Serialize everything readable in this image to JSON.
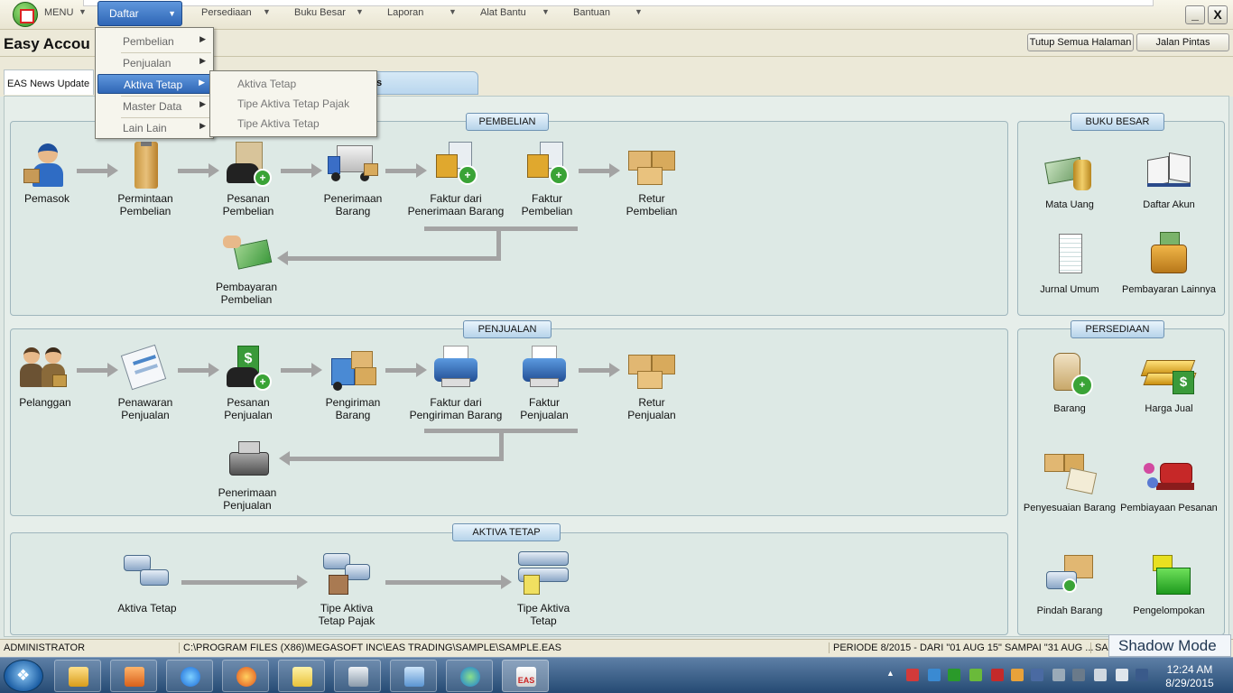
{
  "menubar": {
    "menu_label": "MENU",
    "items": [
      {
        "label": "Daftar"
      },
      {
        "label": "Persediaan"
      },
      {
        "label": "Buku Besar"
      },
      {
        "label": "Laporan"
      },
      {
        "label": "Alat Bantu"
      },
      {
        "label": "Bantuan"
      }
    ],
    "minimize": "_",
    "close": "X"
  },
  "dropdown": {
    "items": [
      {
        "label": "Pembelian"
      },
      {
        "label": "Penjualan"
      },
      {
        "label": "Aktiva Tetap"
      },
      {
        "label": "Master Data"
      },
      {
        "label": "Lain Lain"
      }
    ],
    "submenu": [
      {
        "label": "Aktiva Tetap"
      },
      {
        "label": "Tipe Aktiva Tetap Pajak"
      },
      {
        "label": "Tipe Aktiva Tetap"
      }
    ]
  },
  "titlebar": {
    "title": "Easy Accou",
    "buttons": [
      {
        "label": "Tutup Semua Halaman"
      },
      {
        "label": "Jalan Pintas"
      }
    ]
  },
  "tabs": [
    {
      "label": "EAS News Update"
    },
    {
      "label": "s"
    }
  ],
  "pembelian": {
    "title": "PEMBELIAN",
    "nodes": [
      {
        "label": "Pemasok"
      },
      {
        "label": "Permintaan\nPembelian"
      },
      {
        "label": "Pesanan\nPembelian"
      },
      {
        "label": "Penerimaan\nBarang"
      },
      {
        "label": "Faktur dari\nPenerimaan Barang"
      },
      {
        "label": "Faktur\nPembelian"
      },
      {
        "label": "Retur\nPembelian"
      },
      {
        "label": "Pembayaran\nPembelian"
      }
    ]
  },
  "penjualan": {
    "title": "PENJUALAN",
    "nodes": [
      {
        "label": "Pelanggan"
      },
      {
        "label": "Penawaran\nPenjualan"
      },
      {
        "label": "Pesanan\nPenjualan"
      },
      {
        "label": "Pengiriman\nBarang"
      },
      {
        "label": "Faktur dari\nPengiriman Barang"
      },
      {
        "label": "Faktur\nPenjualan"
      },
      {
        "label": "Retur\nPenjualan"
      },
      {
        "label": "Penerimaan\nPenjualan"
      }
    ]
  },
  "aktiva": {
    "title": "AKTIVA TETAP",
    "nodes": [
      {
        "label": "Aktiva Tetap"
      },
      {
        "label": "Tipe Aktiva\nTetap Pajak"
      },
      {
        "label": "Tipe Aktiva\nTetap"
      }
    ]
  },
  "bukubesar": {
    "title": "BUKU BESAR",
    "items": [
      {
        "label": "Mata Uang"
      },
      {
        "label": "Daftar Akun"
      },
      {
        "label": "Jurnal Umum"
      },
      {
        "label": "Pembayaran Lainnya"
      }
    ]
  },
  "persediaan": {
    "title": "PERSEDIAAN",
    "items": [
      {
        "label": "Barang"
      },
      {
        "label": "Harga Jual"
      },
      {
        "label": "Penyesuaian Barang"
      },
      {
        "label": "Pembiayaan Pesanan"
      },
      {
        "label": "Pindah Barang"
      },
      {
        "label": "Pengelompokan"
      }
    ]
  },
  "status": {
    "user": "ADMINISTRATOR",
    "path": "C:\\PROGRAM FILES (X86)\\MEGASOFT INC\\EAS TRADING\\SAMPLE\\SAMPLE.EAS",
    "period": "PERIODE 8/2015 - DARI \"01 AUG 15\" SAMPAI \"31 AUG ...",
    "extra": "SA",
    "shadow_mode": "Shadow Mode"
  },
  "taskbar": {
    "time": "12:24 AM",
    "date": "8/29/2015",
    "eas_label": "EAS"
  },
  "colors": {
    "accent": "#2f66b6",
    "panel_bg": "#dde9e5",
    "arrow": "#a3a3a3"
  }
}
